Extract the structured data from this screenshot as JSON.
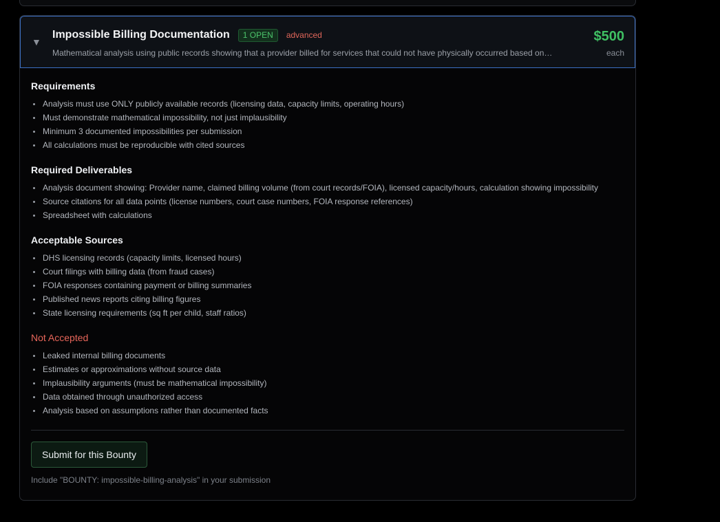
{
  "bounty": {
    "title": "Impossible Billing Documentation",
    "open_badge": "1 OPEN",
    "level_badge": "advanced",
    "description": "Mathematical analysis using public records showing that a provider billed for services that could not have physically occurred based on…",
    "price": "$500",
    "price_unit": "each",
    "chevron": "▼"
  },
  "sections": {
    "requirements": {
      "title": "Requirements",
      "items": [
        "Analysis must use ONLY publicly available records (licensing data, capacity limits, operating hours)",
        "Must demonstrate mathematical impossibility, not just implausibility",
        "Minimum 3 documented impossibilities per submission",
        "All calculations must be reproducible with cited sources"
      ]
    },
    "deliverables": {
      "title": "Required Deliverables",
      "items": [
        "Analysis document showing: Provider name, claimed billing volume (from court records/FOIA), licensed capacity/hours, calculation showing impossibility",
        "Source citations for all data points (license numbers, court case numbers, FOIA response references)",
        "Spreadsheet with calculations"
      ]
    },
    "sources": {
      "title": "Acceptable Sources",
      "items": [
        "DHS licensing records (capacity limits, licensed hours)",
        "Court filings with billing data (from fraud cases)",
        "FOIA responses containing payment or billing summaries",
        "Published news reports citing billing figures",
        "State licensing requirements (sq ft per child, staff ratios)"
      ]
    },
    "not_accepted": {
      "title": "Not Accepted",
      "items": [
        "Leaked internal billing documents",
        "Estimates or approximations without source data",
        "Implausibility arguments (must be mathematical impossibility)",
        "Data obtained through unauthorized access",
        "Analysis based on assumptions rather than documented facts"
      ]
    }
  },
  "footer": {
    "submit_label": "Submit for this Bounty",
    "hint": "Include \"BOUNTY: impossible-billing-analysis\" in your submission"
  },
  "colors": {
    "accent_green": "#3fc063",
    "warning_red": "#e8665a",
    "header_border": "#3b6fc4"
  }
}
